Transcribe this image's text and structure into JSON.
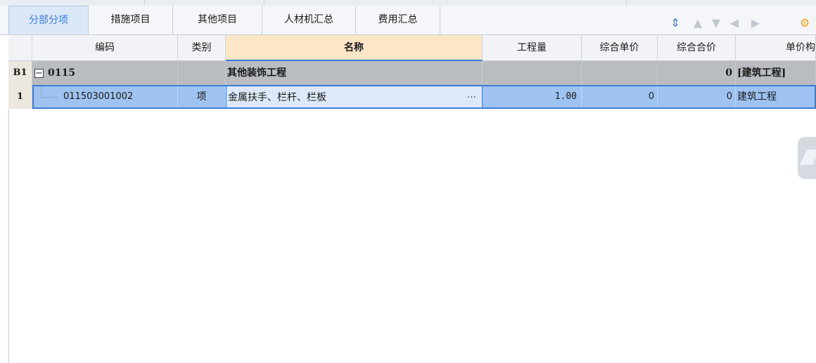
{
  "tabs": [
    {
      "label": "分部分项",
      "active": true
    },
    {
      "label": "措施项目",
      "active": false
    },
    {
      "label": "其他项目",
      "active": false
    },
    {
      "label": "人材机汇总",
      "active": false
    },
    {
      "label": "费用汇总",
      "active": false
    }
  ],
  "toolbar": {
    "icons": [
      "sort-icon",
      "arrow-up-icon",
      "arrow-down-icon",
      "arrow-left-icon",
      "arrow-right-icon",
      "settings-icon"
    ]
  },
  "columns": {
    "code": "编码",
    "type": "类别",
    "name": "名称",
    "quantity": "工程量",
    "unit_price": "综合单价",
    "total_price": "综合合价",
    "unit_spec": "单价构"
  },
  "rows": [
    {
      "num": "B1",
      "expander": "−",
      "code": "0115",
      "type": "",
      "name": "其他装饰工程",
      "quantity": "",
      "unit_price": "",
      "total_price": "0",
      "unit_spec": "[建筑工程]"
    },
    {
      "num": "1",
      "code": "011503001002",
      "type": "项",
      "name": "金属扶手、栏杆、栏板",
      "ellipsis": "···",
      "quantity": "1.00",
      "unit_price": "0",
      "total_price": "0",
      "unit_spec": "建筑工程"
    }
  ],
  "colors": {
    "accent": "#3b7dd8",
    "group_row": "#b9bdc2",
    "selected_row": "#9fc3f0",
    "selected_name_cell": "#dde9f8",
    "name_header": "#fde6c8"
  }
}
